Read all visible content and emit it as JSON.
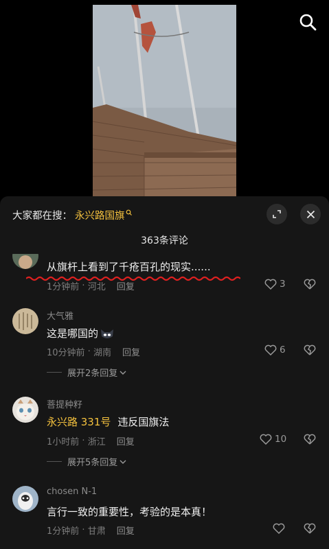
{
  "header": {
    "search_icon": "search-icon"
  },
  "sheet": {
    "search_label": "大家都在搜：",
    "search_keyword": "永兴路国旗",
    "comment_count": "363条评论",
    "expand_icon": "expand-icon",
    "close_icon": "close-icon"
  },
  "comments": [
    {
      "username": "",
      "text": "从旗杆上看到了千疮百孔的现实......",
      "time": "1分钟前",
      "location": "河北",
      "reply_label": "回复",
      "likes": "3"
    },
    {
      "username": "大气雅",
      "text": "这是哪国的",
      "time": "10分钟前",
      "location": "湖南",
      "reply_label": "回复",
      "likes": "6",
      "expand_label": "展开2条回复"
    },
    {
      "username": "菩提种籽",
      "mention": "永兴路 331号",
      "text": "违反国旗法",
      "time": "1小时前",
      "location": "浙江",
      "reply_label": "回复",
      "likes": "10",
      "expand_label": "展开5条回复"
    },
    {
      "username": "chosen N-1",
      "text": "言行一致的重要性，考验的是本真！",
      "time": "1分钟前",
      "location": "甘肃",
      "reply_label": "回复",
      "likes": ""
    }
  ],
  "colors": {
    "accent": "#f5c23e",
    "sheet_bg": "#161616",
    "squiggle": "#e02020"
  }
}
